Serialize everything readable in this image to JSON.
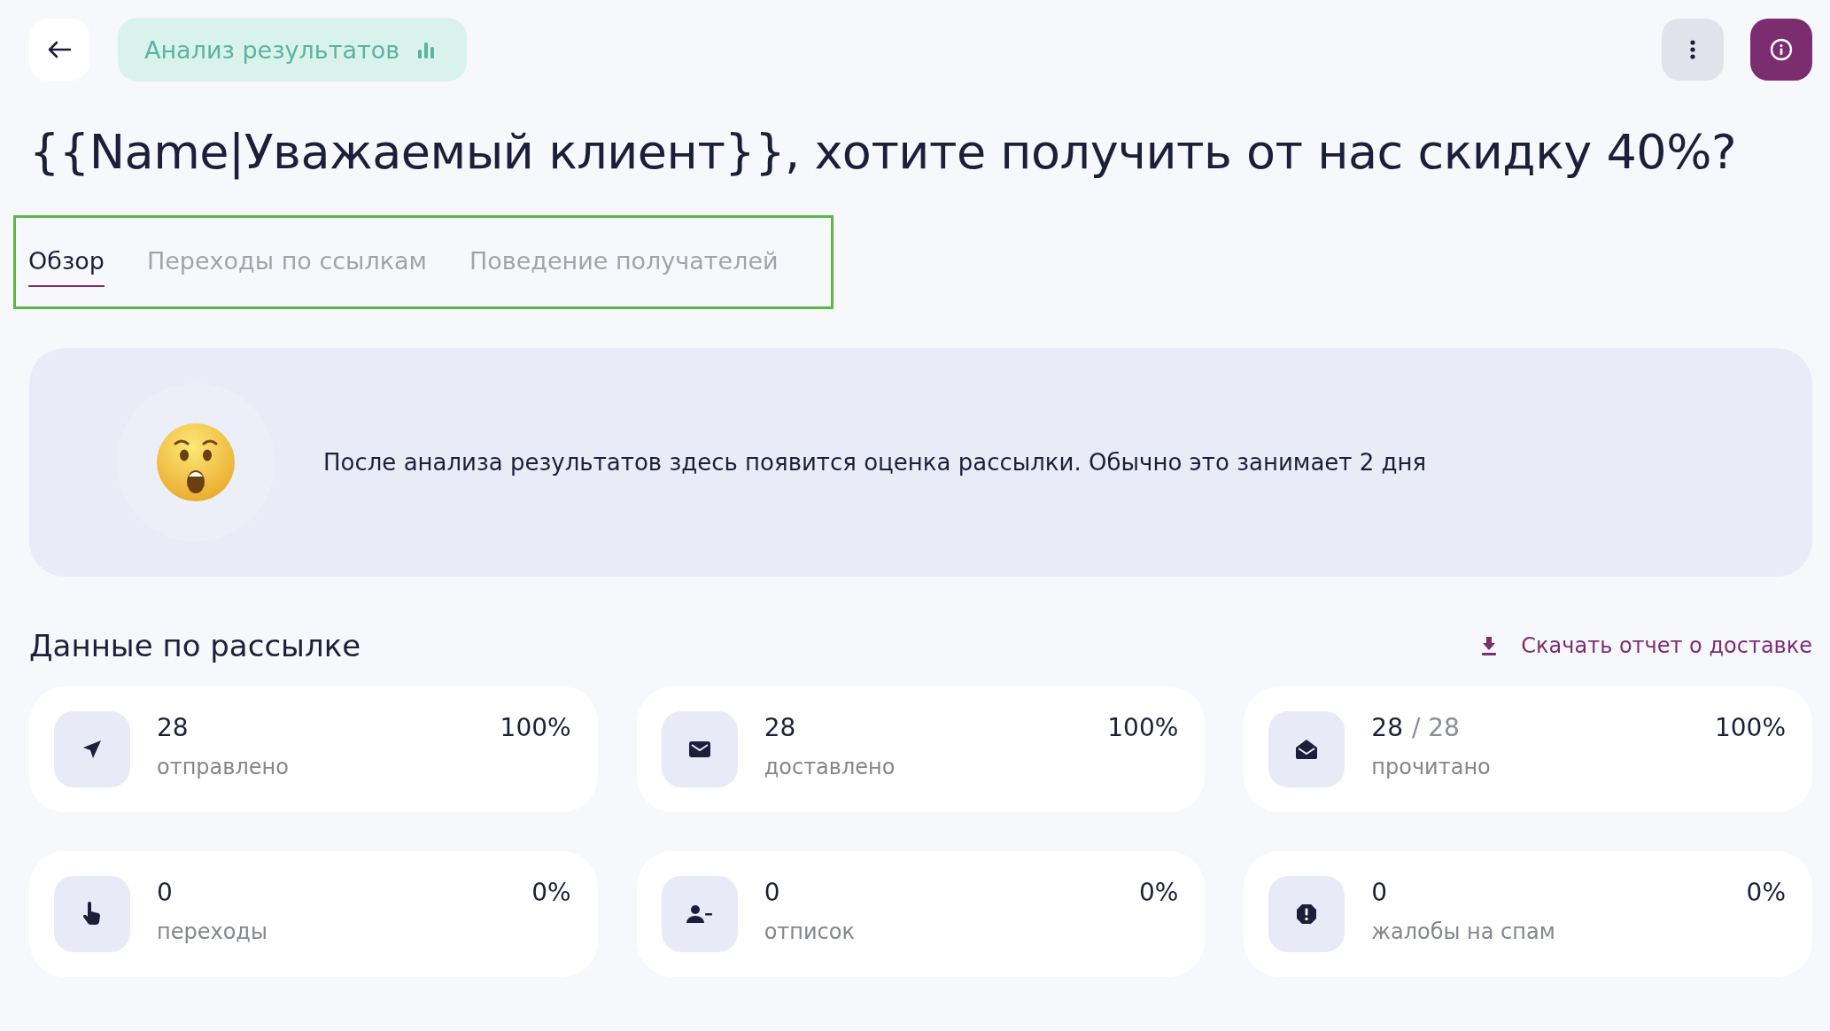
{
  "header": {
    "badge": "Анализ результатов"
  },
  "title": "{{Name|Уважаемый клиент}}, хотите получить от нас скидку 40%?",
  "tabs": [
    {
      "label": "Обзор",
      "selected": true
    },
    {
      "label": "Переходы по ссылкам",
      "selected": false
    },
    {
      "label": "Поведение получателей",
      "selected": false
    }
  ],
  "notice": {
    "text": "После анализа результатов здесь появится оценка рассылки. Обычно это занимает 2 дня"
  },
  "section": {
    "title": "Данные по рассылке",
    "download_link": "Скачать отчет о доставке"
  },
  "stats": [
    {
      "kind": "sent",
      "value": "28",
      "label": "отправлено",
      "percent": "100%"
    },
    {
      "kind": "delivered",
      "value": "28",
      "label": "доставлено",
      "percent": "100%"
    },
    {
      "kind": "read",
      "value": "28",
      "total": "/ 28",
      "label": "прочитано",
      "percent": "100%"
    },
    {
      "kind": "clicks",
      "value": "0",
      "label": "переходы",
      "percent": "0%"
    },
    {
      "kind": "unsubscribed",
      "value": "0",
      "label": "отписок",
      "percent": "0%"
    },
    {
      "kind": "spam",
      "value": "0",
      "label": "жалобы на спам",
      "percent": "0%"
    }
  ]
}
